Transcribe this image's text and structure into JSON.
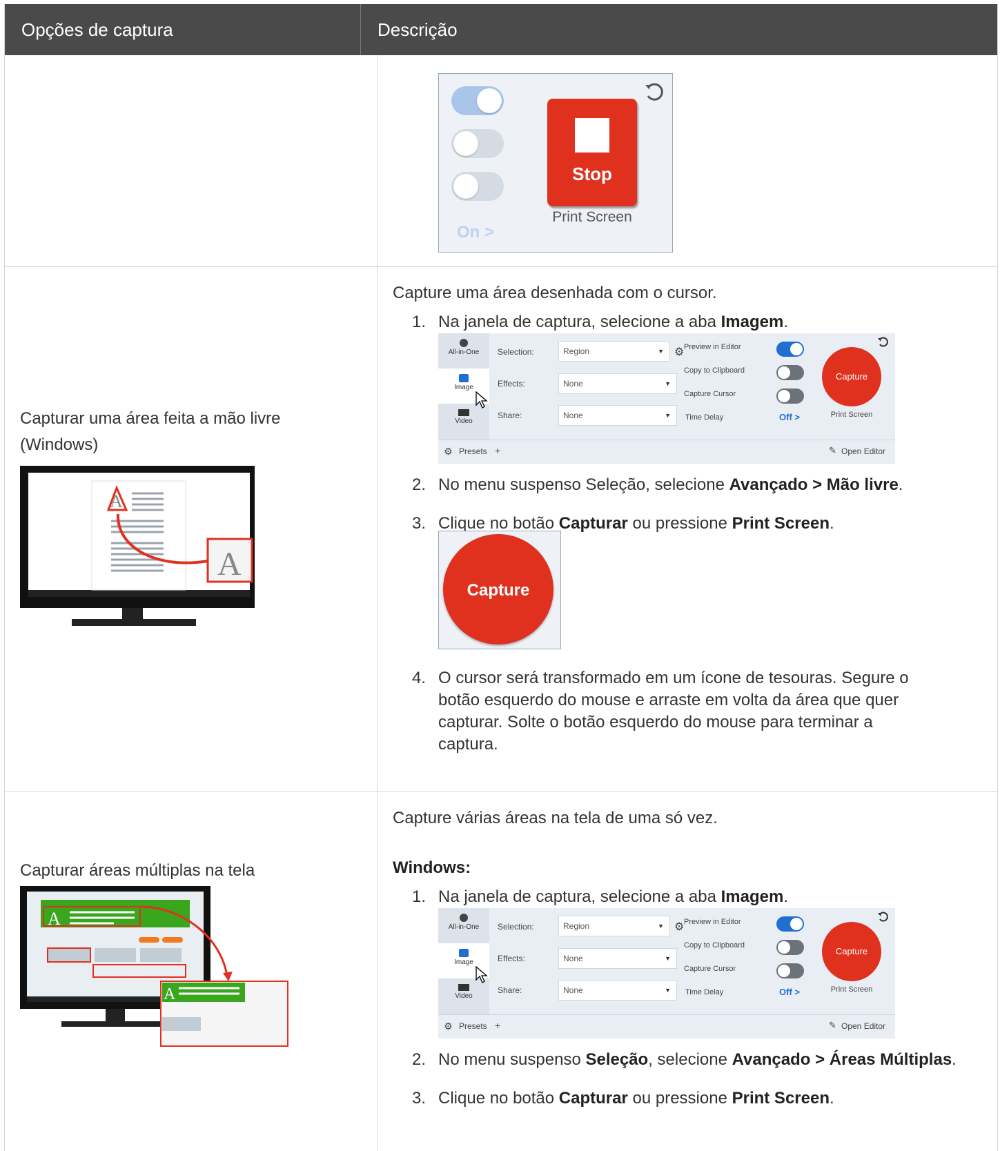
{
  "table": {
    "header": {
      "col1": "Opções de captura",
      "col2": "Descrição"
    }
  },
  "row1": {
    "stop_widget": {
      "stop_label": "Stop",
      "print_screen": "Print Screen",
      "on_label": "On >"
    }
  },
  "row2": {
    "option": "Capturar uma área feita a mão livre (Windows)",
    "option_line1": "Capturar uma área feita a mão livre",
    "option_line2": "(Windows)",
    "intro": "Capture uma área desenhada com o cursor.",
    "steps": [
      {
        "num": "1.",
        "pre": "Na janela de captura, selecione a aba ",
        "bold": "Imagem",
        "post": "."
      },
      {
        "num": "2.",
        "pre": "No menu suspenso Seleção, selecione ",
        "bold": "Avançado > Mão livre",
        "post": "."
      },
      {
        "num": "3.",
        "pre": "Clique no botão ",
        "bold": "Capturar",
        "mid": " ou pressione ",
        "bold2": "Print Screen",
        "post": "."
      },
      {
        "num": "4.",
        "lines": [
          "O cursor será transformado em um ícone de tesouras. Segure o",
          "botão esquerdo do mouse e arraste em volta da área que quer",
          "capturar. Solte o botão esquerdo do mouse para terminar a",
          "captura."
        ]
      }
    ],
    "big_capture": "Capture"
  },
  "row3": {
    "option": "Capturar áreas múltiplas na tela",
    "intro": "Capture várias áreas na tela de uma só vez.",
    "windows_heading": "Windows:",
    "steps": [
      {
        "num": "1.",
        "pre": "Na janela de captura, selecione a aba ",
        "bold": "Imagem",
        "post": "."
      },
      {
        "num": "2.",
        "pre": "No menu suspenso ",
        "bold": "Seleção",
        "mid": ", selecione ",
        "bold2": "Avançado > Áreas Múltiplas",
        "post": "."
      },
      {
        "num": "3.",
        "pre": "Clique no botão ",
        "bold": "Capturar",
        "mid": " ou pressione ",
        "bold2": "Print Screen",
        "post": "."
      }
    ]
  },
  "panel": {
    "tabs": [
      "All-in-One",
      "Image",
      "Video"
    ],
    "selection_label": "Selection:",
    "selection_value": "Region",
    "effects_label": "Effects:",
    "effects_value": "None",
    "share_label": "Share:",
    "share_value": "None",
    "preview_label": "Preview in Editor",
    "clipboard_label": "Copy to Clipboard",
    "cursor_label": "Capture Cursor",
    "delay_label": "Time Delay",
    "delay_value": "Off >",
    "capture_label": "Capture",
    "print_screen": "Print Screen",
    "presets": "Presets",
    "add": "+",
    "open_editor": "Open Editor"
  },
  "colors": {
    "header_bg": "#4a4a4a",
    "capture_red": "#e0301e",
    "toggle_on": "#1f6fd1",
    "toggle_off": "#c5ccd5"
  }
}
